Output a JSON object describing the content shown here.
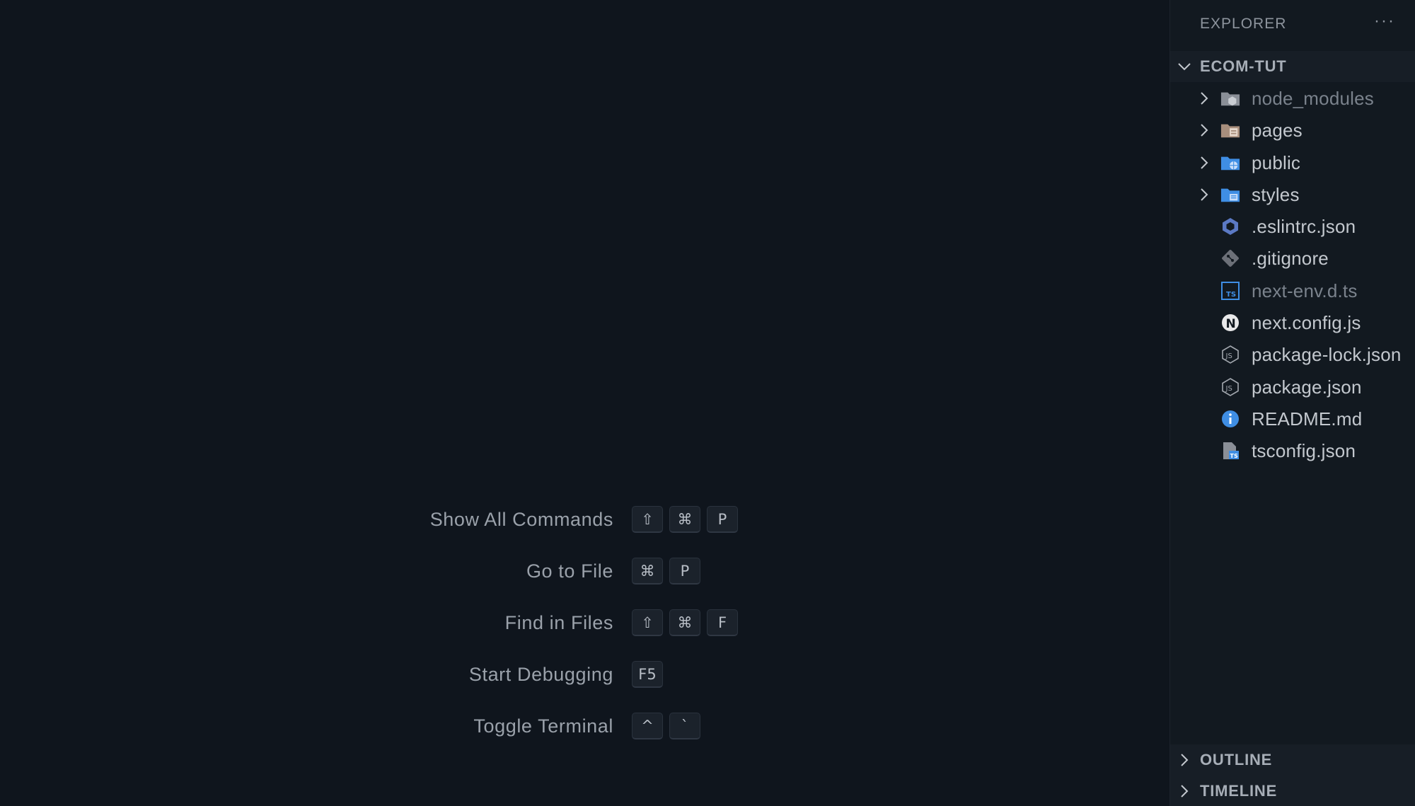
{
  "editor": {
    "shortcuts": [
      {
        "label": "Show All Commands",
        "keys": [
          "⇧",
          "⌘",
          "P"
        ]
      },
      {
        "label": "Go to File",
        "keys": [
          "⌘",
          "P"
        ]
      },
      {
        "label": "Find in Files",
        "keys": [
          "⇧",
          "⌘",
          "F"
        ]
      },
      {
        "label": "Start Debugging",
        "keys": [
          "F5"
        ]
      },
      {
        "label": "Toggle Terminal",
        "keys": [
          "^",
          "`"
        ]
      }
    ]
  },
  "sidebar": {
    "title": "EXPLORER",
    "more_label": "···",
    "project": {
      "name": "ECOM-TUT",
      "items": [
        {
          "name": "node_modules",
          "type": "folder",
          "icon": "node-folder-icon",
          "dimmed": true
        },
        {
          "name": "pages",
          "type": "folder",
          "icon": "pages-folder-icon",
          "dimmed": false
        },
        {
          "name": "public",
          "type": "folder",
          "icon": "public-folder-icon",
          "dimmed": false
        },
        {
          "name": "styles",
          "type": "folder",
          "icon": "styles-folder-icon",
          "dimmed": false
        },
        {
          "name": ".eslintrc.json",
          "type": "file",
          "icon": "eslint-icon",
          "dimmed": false
        },
        {
          "name": ".gitignore",
          "type": "file",
          "icon": "git-icon",
          "dimmed": false
        },
        {
          "name": "next-env.d.ts",
          "type": "file",
          "icon": "typescript-icon",
          "dimmed": true
        },
        {
          "name": "next.config.js",
          "type": "file",
          "icon": "nextjs-icon",
          "dimmed": false
        },
        {
          "name": "package-lock.json",
          "type": "file",
          "icon": "nodejs-icon",
          "dimmed": false
        },
        {
          "name": "package.json",
          "type": "file",
          "icon": "nodejs-icon",
          "dimmed": false
        },
        {
          "name": "README.md",
          "type": "file",
          "icon": "info-icon",
          "dimmed": false
        },
        {
          "name": "tsconfig.json",
          "type": "file",
          "icon": "tsconfig-icon",
          "dimmed": false
        }
      ]
    },
    "outline_label": "OUTLINE",
    "timeline_label": "TIMELINE"
  },
  "colors": {
    "editor_bg": "#0f151d",
    "sidebar_bg": "#121920",
    "text": "#c3c8ce",
    "dim_text": "#7a828c"
  }
}
